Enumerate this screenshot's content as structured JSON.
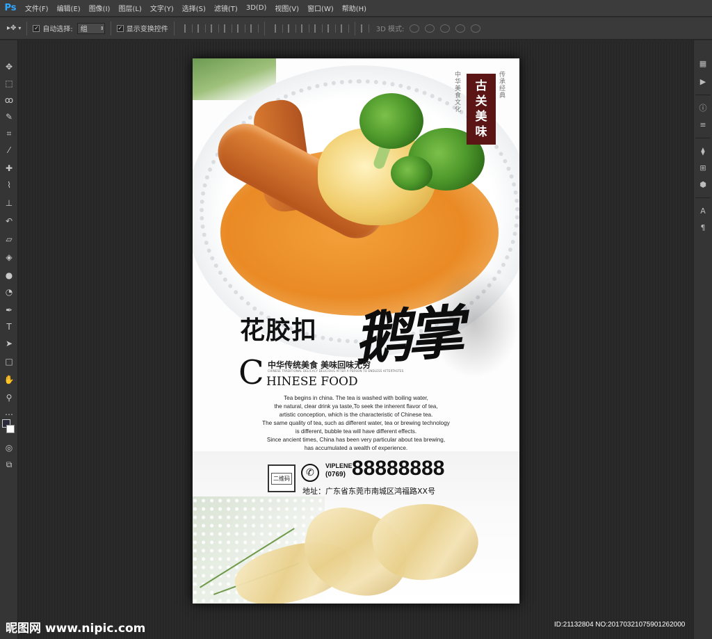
{
  "app": {
    "logo_text": "Ps"
  },
  "menu": {
    "items": [
      "文件(F)",
      "编辑(E)",
      "图像(I)",
      "图层(L)",
      "文字(Y)",
      "选择(S)",
      "滤镜(T)",
      "3D(D)",
      "视图(V)",
      "窗口(W)",
      "帮助(H)"
    ]
  },
  "options": {
    "auto_select_label": "自动选择:",
    "auto_select_checked": true,
    "auto_select_value": "组",
    "show_transform_label": "显示变换控件",
    "show_transform_checked": true,
    "mode_3d_label": "3D 模式:"
  },
  "poster": {
    "seal_chars": [
      "古",
      "关",
      "美",
      "味"
    ],
    "vertical_text_1": "中华美食文化",
    "vertical_text_2": "传承经典",
    "title_main": "花胶扣",
    "title_brush": "鹅掌",
    "subtitle_cn": "中华传统美食  美味回味无穷",
    "subtitle_tiny": "CHINESE TRADITIONAL DELICACY DELICIOUS AFTER A PERSON TO ENDLESS AFTERTASTES",
    "subtitle_en_initial": "C",
    "subtitle_en_rest": "HINESE FOOD",
    "paragraph": [
      "Tea begins in china. The tea is washed with boiling water,",
      "the natural, clear drink ya taste,To seek the inherent flavor of tea,",
      "artistic conception, which is the characteristic of Chinese tea.",
      "The same quality of tea, such as different water, tea or brewing technology",
      "is different, bubble tea will have different effects.",
      "Since ancient times, China has been very particular about tea brewing,",
      "has accumulated a wealth of experience."
    ],
    "qr_label": "二维码",
    "brand": "VIPLENE",
    "area_code": "(0769)",
    "phone": "88888888",
    "address": "地址：广东省东莞市南城区鸿福路XX号"
  },
  "watermark": {
    "left": "昵图网 www.nipic.com",
    "right": "ID:21132804 NO:20170321075901262000"
  },
  "colors": {
    "accent_seal": "#5b1515",
    "ps_blue": "#31a8ff",
    "canvas_bg": "#282828"
  }
}
